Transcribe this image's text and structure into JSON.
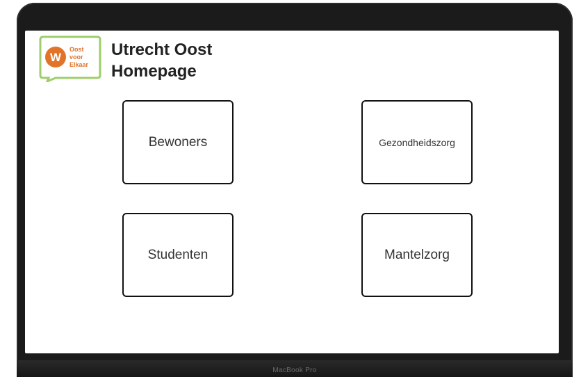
{
  "header": {
    "title_line1": "Utrecht Oost",
    "title_line2": "Homepage"
  },
  "logo": {
    "line1": "Oost",
    "line2": "voor",
    "line3": "Elkaar",
    "initial": "W",
    "brand_color": "#e2742a",
    "frame_color": "#9fcd6c"
  },
  "tiles": [
    {
      "label": "Bewoners"
    },
    {
      "label": "Gezondheidszorg"
    },
    {
      "label": "Studenten"
    },
    {
      "label": "Mantelzorg"
    }
  ],
  "device": {
    "brand_label": "MacBook Pro"
  }
}
